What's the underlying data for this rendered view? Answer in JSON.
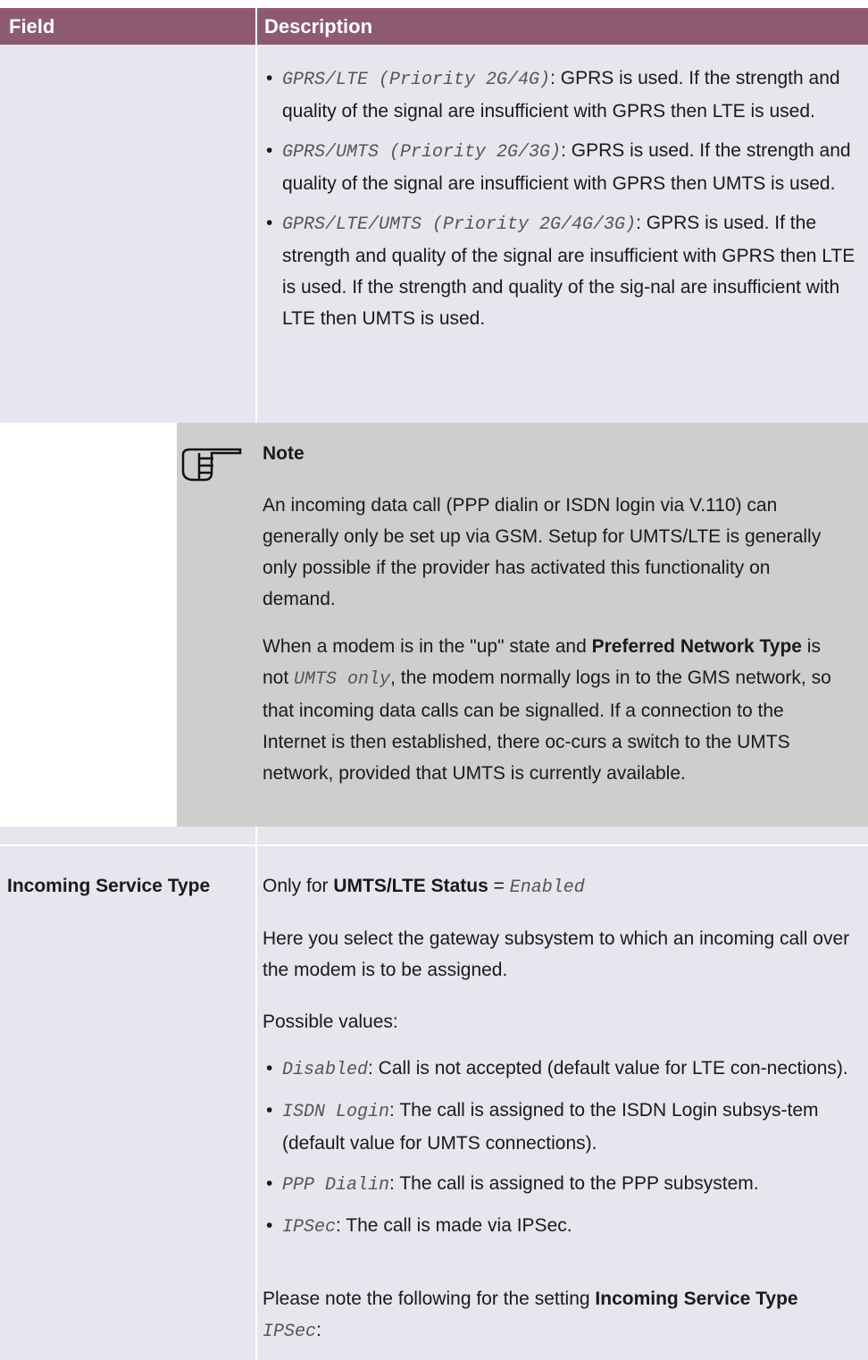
{
  "header": {
    "field": "Field",
    "description": "Description"
  },
  "top_bullets": [
    {
      "code": "GPRS/LTE (Priority 2G/4G)",
      "text": ": GPRS is used. If the strength and quality of the signal are insufficient with GPRS then LTE is used."
    },
    {
      "code": "GPRS/UMTS (Priority 2G/3G)",
      "text": ": GPRS is used. If the strength and quality of the signal are insufficient with GPRS then UMTS is used."
    },
    {
      "code": "GPRS/LTE/UMTS (Priority 2G/4G/3G)",
      "text": ": GPRS is used. If the strength and quality of the signal are insufficient with GPRS then LTE is used. If the strength and quality of the sig-nal are insufficient with LTE then UMTS is used."
    }
  ],
  "note": {
    "title": "Note",
    "p1": "An incoming data call (PPP dialin or ISDN login via V.110) can generally only be set up via GSM. Setup for UMTS/LTE is generally only possible if the provider has activated this functionality on demand.",
    "p2_a": "When a modem is in the \"up\" state and ",
    "p2_b": "Preferred Network Type",
    "p2_c": " is not ",
    "p2_d": "UMTS only",
    "p2_e": ", the modem normally logs in to the GMS network, so that incoming data calls can be signalled. If a connection to the Internet is then established, there oc-curs a switch to the UMTS network, provided that UMTS is currently available."
  },
  "row": {
    "field": "Incoming Service Type",
    "only_for_a": "Only for ",
    "only_for_b": "UMTS/LTE Status",
    "only_for_c": " = ",
    "only_for_d": "Enabled",
    "p1": "Here you select the gateway subsystem to which an incoming call over the modem is to be assigned.",
    "p2": "Possible values:",
    "bullets": [
      {
        "code": "Disabled",
        "text": ": Call is not accepted (default value for LTE con-nections)."
      },
      {
        "code": "ISDN Login",
        "text": ": The call is assigned to the ISDN Login subsys-tem (default value for UMTS connections)."
      },
      {
        "code": "PPP Dialin",
        "text": ": The call is assigned to the PPP subsystem."
      },
      {
        "code": "IPSec",
        "text": ": The call is made via IPSec."
      }
    ],
    "p3_a": "Please note the following for the setting ",
    "p3_b": "Incoming Service Type",
    "p3_c": " ",
    "p3_d": "IPSec",
    "p3_e": ":"
  }
}
